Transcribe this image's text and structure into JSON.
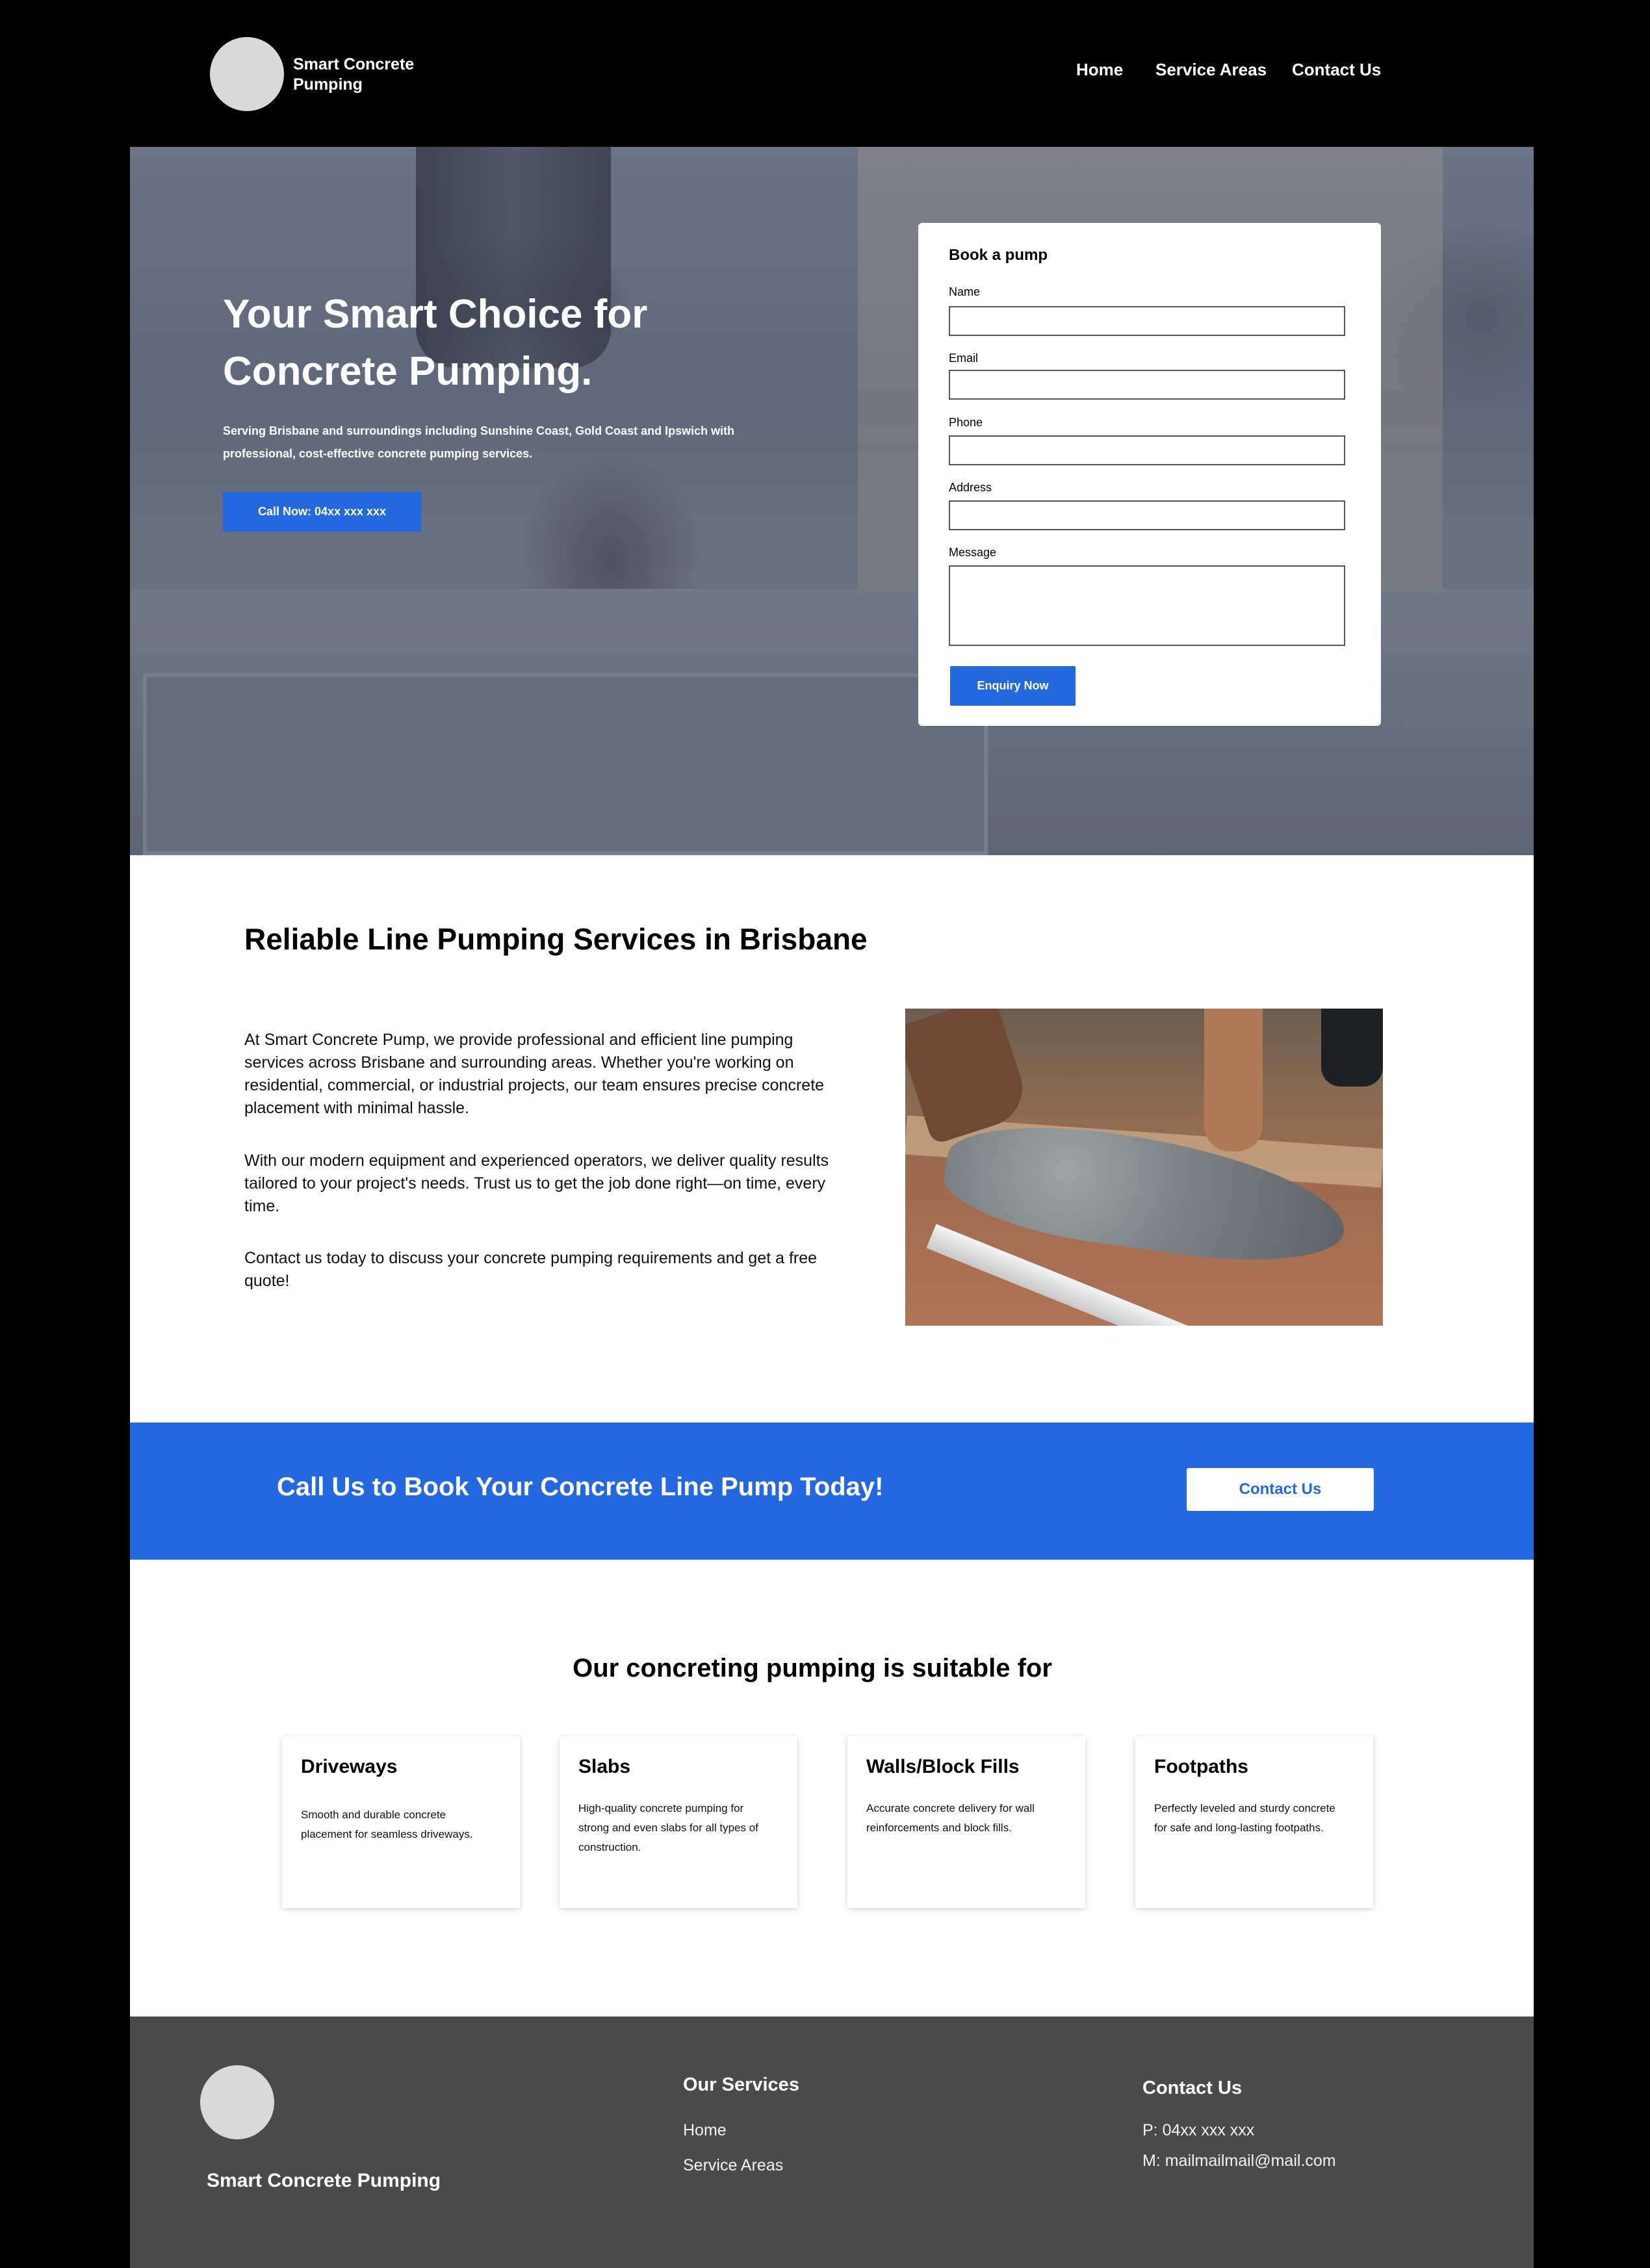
{
  "header": {
    "brand": "Smart Concrete Pumping",
    "nav": {
      "home": "Home",
      "service_areas": "Service Areas",
      "contact": "Contact Us"
    }
  },
  "hero": {
    "title": "Your Smart Choice for Concrete Pumping.",
    "subtitle": "Serving Brisbane and surroundings including Sunshine Coast, Gold Coast and Ipswich with professional, cost-effective concrete pumping services.",
    "call_button": "Call Now:  04xx xxx xxx"
  },
  "booking_form": {
    "title": "Book a pump",
    "fields": {
      "name": {
        "label": "Name",
        "value": ""
      },
      "email": {
        "label": "Email",
        "value": ""
      },
      "phone": {
        "label": "Phone",
        "value": ""
      },
      "address": {
        "label": "Address",
        "value": ""
      },
      "message": {
        "label": "Message",
        "value": ""
      }
    },
    "submit": "Enquiry Now"
  },
  "about": {
    "title": "Reliable Line Pumping Services in Brisbane",
    "paragraphs": [
      "At Smart Concrete Pump, we provide professional and efficient line pumping services across Brisbane and surrounding areas. Whether you're working on residential, commercial, or industrial projects, our team ensures precise concrete placement with minimal hassle.",
      "With our modern equipment and experienced operators, we deliver quality results tailored to your project's needs. Trust us to get the job done right—on time, every time.",
      "Contact us today to discuss your concrete pumping requirements and get a free quote!"
    ]
  },
  "cta": {
    "text": "Call Us to Book Your Concrete Line Pump Today!",
    "button": "Contact Us"
  },
  "suitable": {
    "title": "Our concreting pumping is suitable for",
    "cards": [
      {
        "title": "Driveways",
        "desc": "Smooth and durable concrete placement for seamless driveways."
      },
      {
        "title": "Slabs",
        "desc": "High-quality concrete pumping for strong and even slabs for all types of construction."
      },
      {
        "title": "Walls/Block Fills",
        "desc": "Accurate concrete delivery for wall reinforcements and block fills."
      },
      {
        "title": "Footpaths",
        "desc": "Perfectly leveled and sturdy concrete for safe and long-lasting footpaths."
      }
    ]
  },
  "footer": {
    "brand": "Smart Concrete Pumping",
    "services": {
      "heading": "Our Services",
      "links": [
        "Home",
        "Service Areas"
      ]
    },
    "contact": {
      "heading": "Contact Us",
      "phone": "P: 04xx xxx xxx",
      "email": "M: mailmailmail@mail.com"
    }
  },
  "colors": {
    "accent": "#2468df",
    "header_bg": "#000000",
    "footer_bg": "#4a4a4a"
  }
}
